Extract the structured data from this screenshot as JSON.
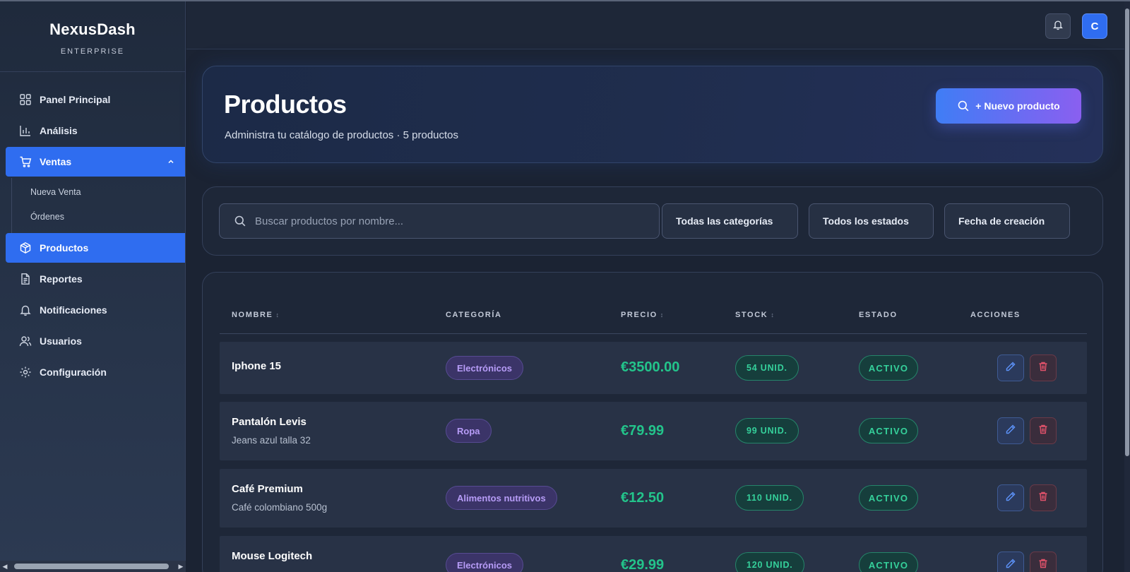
{
  "sidebar": {
    "brand": "NexusDash",
    "edition": "ENTERPRISE",
    "items": [
      {
        "label": "Panel Principal",
        "icon": "grid-icon"
      },
      {
        "label": "Análisis",
        "icon": "bar-chart-icon"
      },
      {
        "label": "Ventas",
        "icon": "cart-icon"
      },
      {
        "label": "Productos",
        "icon": "box-icon"
      },
      {
        "label": "Reportes",
        "icon": "document-icon"
      },
      {
        "label": "Notificaciones",
        "icon": "bell-icon"
      },
      {
        "label": "Usuarios",
        "icon": "users-icon"
      },
      {
        "label": "Configuración",
        "icon": "gear-icon"
      }
    ],
    "ventas_sub": [
      "Nueva Venta",
      "Órdenes"
    ]
  },
  "header": {
    "avatar_initial": "C"
  },
  "hero": {
    "title": "Productos",
    "subtitle": "Administra tu catálogo de productos · 5 productos",
    "new_button": "+ Nuevo producto"
  },
  "filters": {
    "search_placeholder": "Buscar productos por nombre...",
    "category": "Todas las categorías",
    "status": "Todos los estados",
    "sort": "Fecha de creación"
  },
  "table": {
    "headers": {
      "name": "NOMBRE",
      "category": "CATEGORÍA",
      "price": "PRECIO",
      "stock": "STOCK",
      "status": "ESTADO",
      "actions": "ACCIONES"
    },
    "rows": [
      {
        "name": "Iphone 15",
        "desc": "",
        "category": "Electrónicos",
        "price": "€3500.00",
        "stock": "54 UNID.",
        "status": "ACTIVO"
      },
      {
        "name": "Pantalón Levis",
        "desc": "Jeans azul talla 32",
        "category": "Ropa",
        "price": "€79.99",
        "stock": "99 UNID.",
        "status": "ACTIVO"
      },
      {
        "name": "Café Premium",
        "desc": "Café colombiano 500g",
        "category": "Alimentos nutritivos",
        "price": "€12.50",
        "stock": "110 UNID.",
        "status": "ACTIVO"
      },
      {
        "name": "Mouse Logitech",
        "desc": "",
        "category": "Electrónicos",
        "price": "€29.99",
        "stock": "120 UNID.",
        "status": "ACTIVO"
      }
    ]
  },
  "colors": {
    "accent": "#2f6df0",
    "success": "#23c48b",
    "category_pill": "#b79cf7",
    "danger": "#e0526a"
  }
}
